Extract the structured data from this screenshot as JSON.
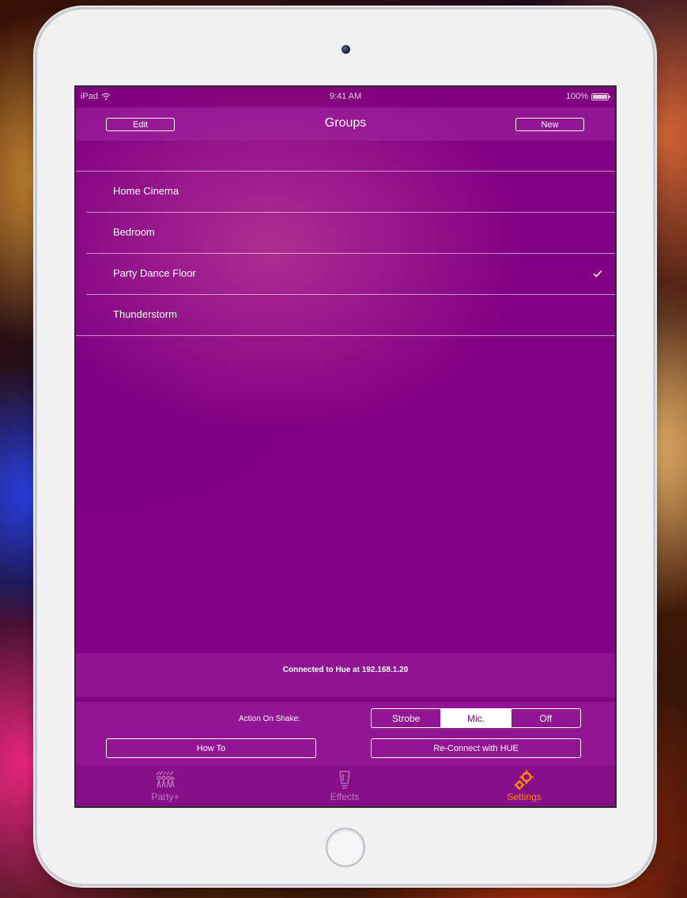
{
  "status_bar": {
    "device": "iPad",
    "time": "9:41 AM",
    "battery": "100%"
  },
  "nav": {
    "title": "Groups",
    "edit_label": "Edit",
    "new_label": "New"
  },
  "groups": [
    {
      "label": "Home Cinema",
      "checked": false
    },
    {
      "label": "Bedroom",
      "checked": false
    },
    {
      "label": "Party Dance Floor",
      "checked": true
    },
    {
      "label": "Thunderstorm",
      "checked": false
    }
  ],
  "connection_status": "Connected to Hue at 192.168.1.20",
  "shake": {
    "label": "Action On Shake:",
    "options": [
      "Strobe",
      "Mic.",
      "Off"
    ],
    "selected": "Mic."
  },
  "buttons": {
    "how_to": "How To",
    "reconnect": "Re-Connect with HUE"
  },
  "tabs": [
    {
      "label": "Party+",
      "icon": "party-crowd-icon",
      "active": false
    },
    {
      "label": "Effects",
      "icon": "bulb-icon",
      "active": false
    },
    {
      "label": "Settings",
      "icon": "gears-icon",
      "active": true
    }
  ],
  "colors": {
    "background": "#810084",
    "accent": "#ff8a00",
    "text": "#ffffff"
  }
}
